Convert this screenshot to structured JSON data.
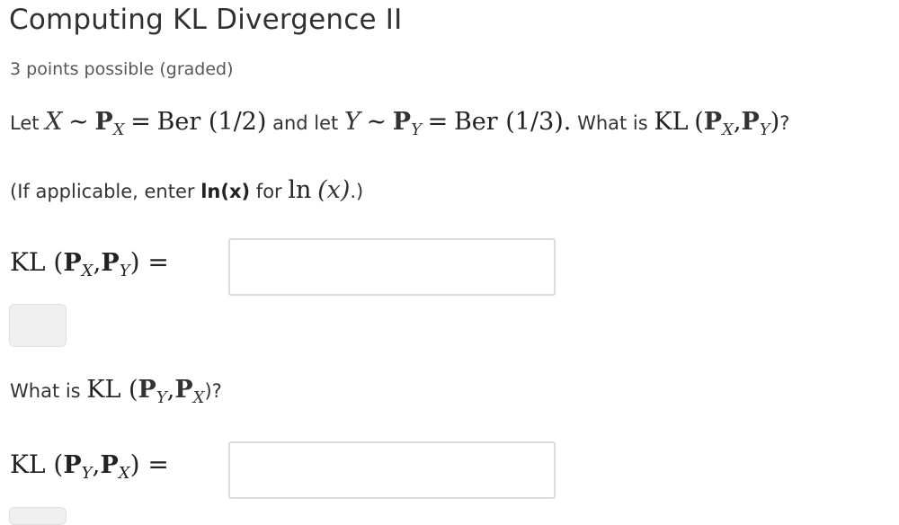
{
  "problem": {
    "title": "Computing KL Divergence II",
    "points": "3 points possible (graded)"
  },
  "question1": {
    "let": "Let",
    "X": "X",
    "sim": "∼",
    "P": "P",
    "subX": "X",
    "eq": "=",
    "ber1": "Ber (1/2)",
    "andlet": "and let",
    "Y": "Y",
    "subY": "Y",
    "ber2": "Ber (1/3).",
    "whatis": "What is",
    "kl": "KL",
    "open": "(",
    "comma": ",",
    "close": ")",
    "qmark": "?"
  },
  "hint": {
    "prefix": "(If applicable, enter",
    "code": "ln(x)",
    "mid": "for",
    "ln": "ln",
    "x": "(x)",
    "suffix": ".)"
  },
  "answer1": {
    "label_kl": "KL (",
    "label_p": "P",
    "label_x": "X",
    "label_comma": ",",
    "label_p2": "P",
    "label_y": "Y",
    "label_end": ") =",
    "value": ""
  },
  "question2": {
    "whatis": "What is",
    "kl": "KL (",
    "p": "P",
    "sy": "Y",
    "comma": ",",
    "p2": "P",
    "sx": "X",
    "end": ")?"
  },
  "answer2": {
    "label_kl": "KL (",
    "label_p": "P",
    "label_y": "Y",
    "label_comma": ",",
    "label_p2": "P",
    "label_x": "X",
    "label_end": ") =",
    "value": ""
  }
}
